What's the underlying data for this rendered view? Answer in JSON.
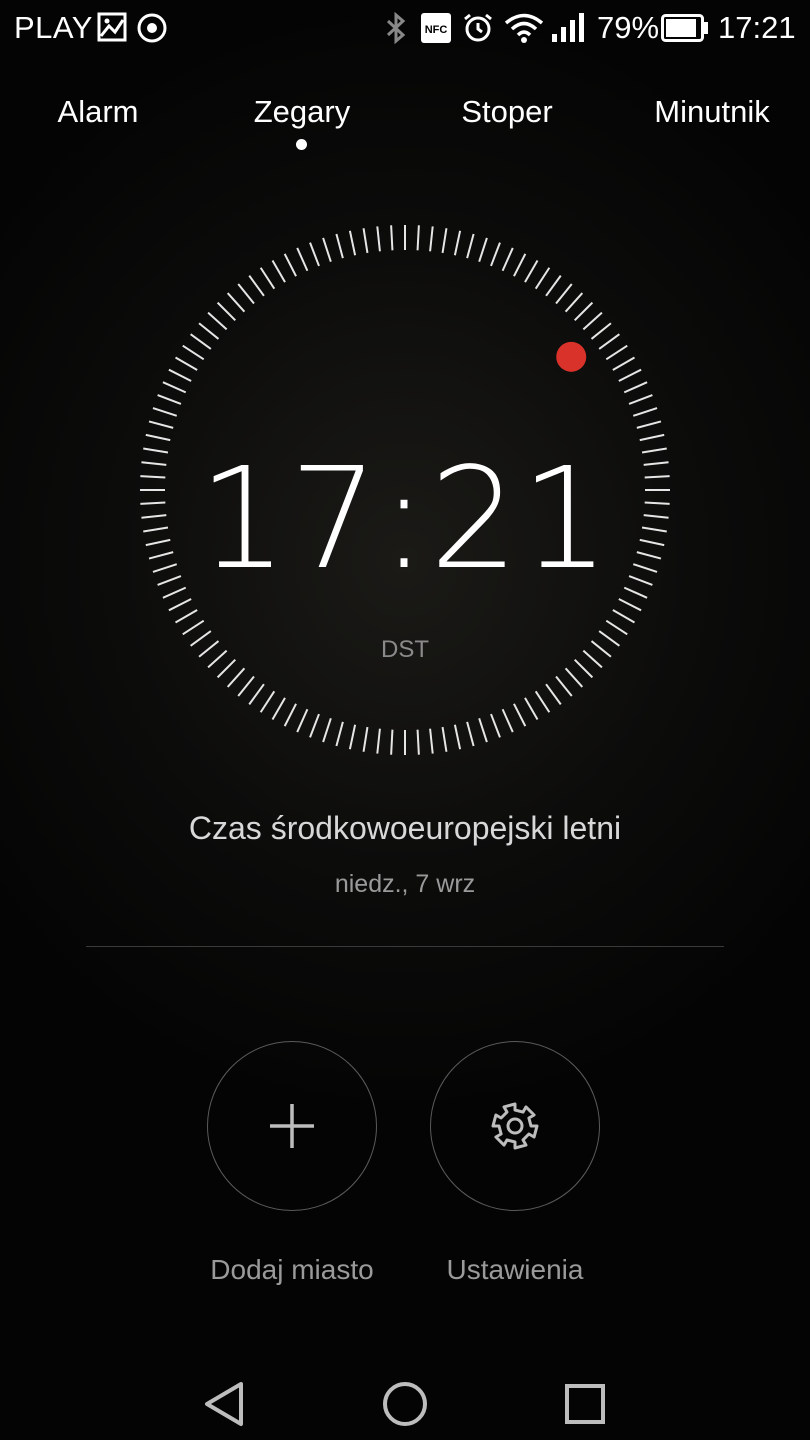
{
  "status_bar": {
    "carrier": "PLAY",
    "battery_percent": "79%",
    "time": "17:21",
    "icons": [
      "gallery-icon",
      "sync-icon",
      "bluetooth-icon",
      "nfc-icon",
      "alarm-icon",
      "wifi-icon",
      "signal-icon",
      "battery-icon"
    ]
  },
  "tabs": [
    {
      "label": "Alarm"
    },
    {
      "label": "Zegary",
      "active": true
    },
    {
      "label": "Stoper"
    },
    {
      "label": "Minutnik"
    }
  ],
  "clock": {
    "time": "17:21",
    "dst_label": "DST",
    "seconds_marker_color": "#d9322a"
  },
  "timezone": {
    "name": "Czas środkowoeuropejski letni",
    "date": "niedz., 7 wrz"
  },
  "actions": {
    "add_city": {
      "label": "Dodaj miasto",
      "icon": "plus-icon"
    },
    "settings": {
      "label": "Ustawienia",
      "icon": "gear-icon"
    }
  },
  "navigation": {
    "icons": [
      "back-icon",
      "home-icon",
      "recents-icon"
    ]
  }
}
